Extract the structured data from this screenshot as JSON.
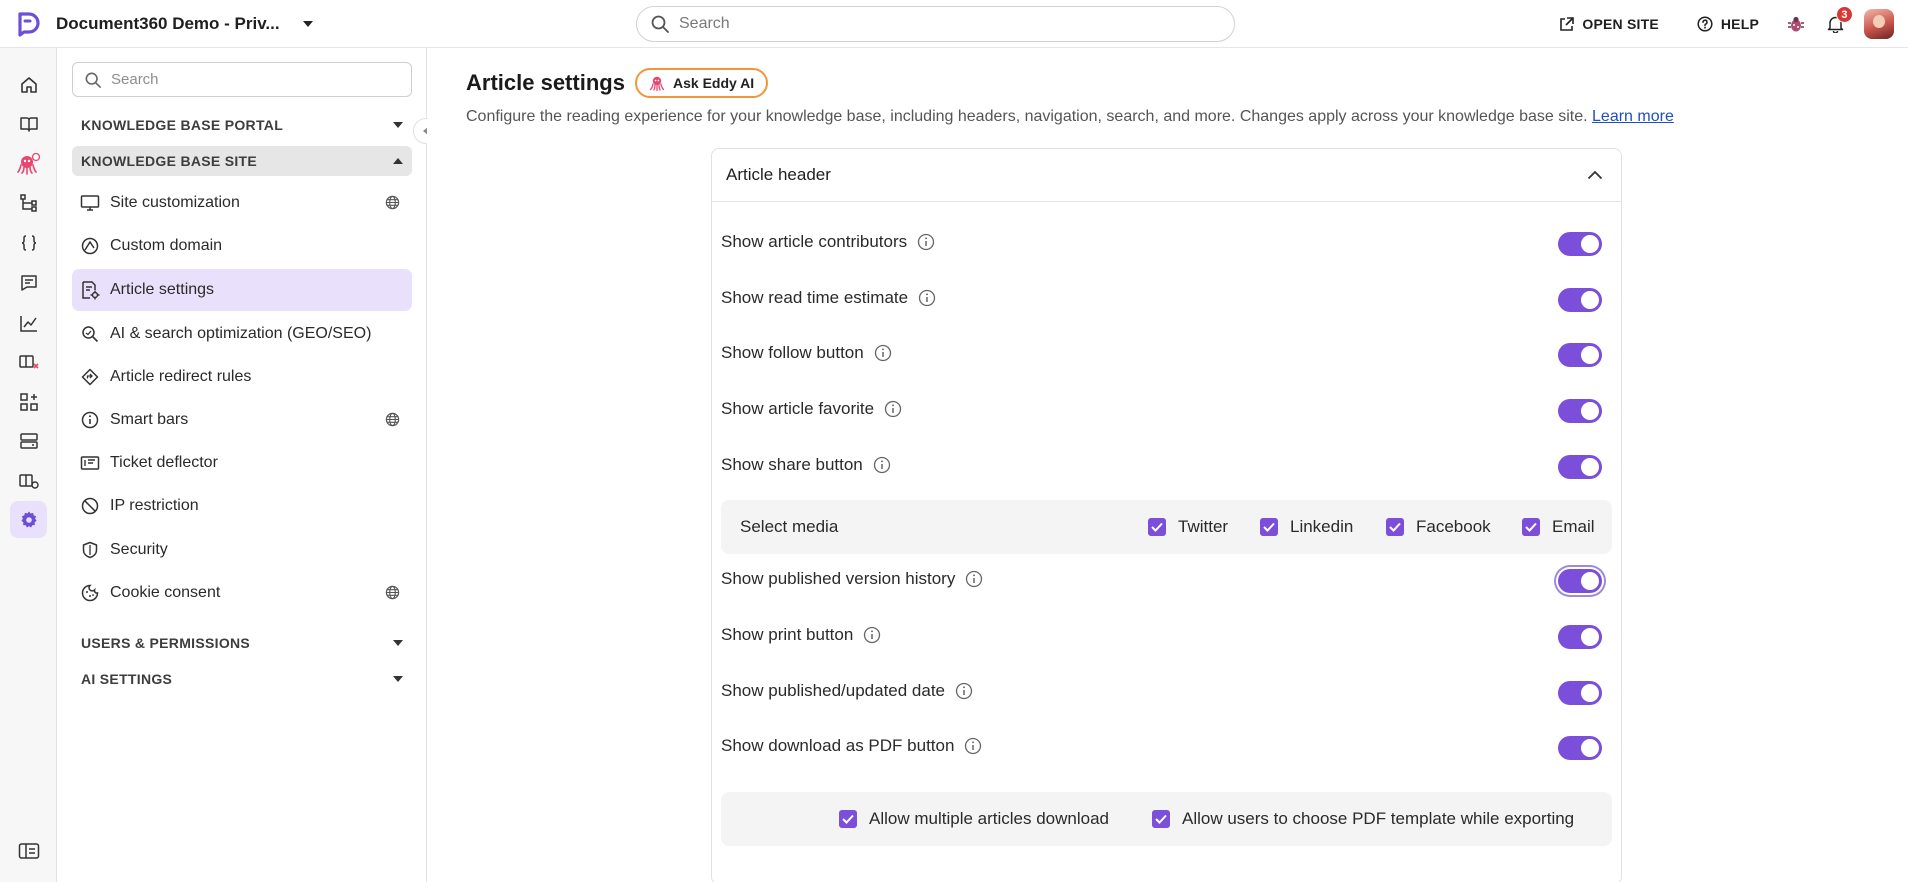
{
  "topbar": {
    "project_name": "Document360 Demo - Priv...",
    "search_placeholder": "Search",
    "open_site": "OPEN SITE",
    "help": "HELP",
    "notifications_count": "3"
  },
  "sidebar": {
    "search_placeholder": "Search",
    "sections": {
      "portal": "KNOWLEDGE BASE PORTAL",
      "site": "KNOWLEDGE BASE SITE",
      "users": "USERS & PERMISSIONS",
      "ai": "AI SETTINGS"
    },
    "items": [
      {
        "label": "Site customization",
        "icon": "monitor-icon",
        "globe": true
      },
      {
        "label": "Custom domain",
        "icon": "domain-icon",
        "globe": false
      },
      {
        "label": "Article settings",
        "icon": "article-settings-icon",
        "globe": false,
        "active": true
      },
      {
        "label": "AI & search optimization (GEO/SEO)",
        "icon": "search-optimization-icon",
        "globe": false
      },
      {
        "label": "Article redirect rules",
        "icon": "redirect-icon",
        "globe": false
      },
      {
        "label": "Smart bars",
        "icon": "info-icon",
        "globe": true
      },
      {
        "label": "Ticket deflector",
        "icon": "ticket-icon",
        "globe": false
      },
      {
        "label": "IP restriction",
        "icon": "block-icon",
        "globe": false
      },
      {
        "label": "Security",
        "icon": "shield-icon",
        "globe": false
      },
      {
        "label": "Cookie consent",
        "icon": "cookie-icon",
        "globe": true
      }
    ]
  },
  "main": {
    "title": "Article settings",
    "ask_eddy": "Ask Eddy AI",
    "description": "Configure the reading experience for your knowledge base, including headers, navigation, search, and more. Changes apply across your knowledge base site.",
    "learn_more": "Learn more",
    "panel_title": "Article header",
    "rows": [
      {
        "label": "Show article contributors",
        "on": true
      },
      {
        "label": "Show read time estimate",
        "on": true
      },
      {
        "label": "Show follow button",
        "on": true
      },
      {
        "label": "Show article favorite",
        "on": true
      },
      {
        "label": "Show share button",
        "on": true
      },
      {
        "label": "Show published version history",
        "on": true
      },
      {
        "label": "Show print button",
        "on": true
      },
      {
        "label": "Show published/updated date",
        "on": true
      },
      {
        "label": "Show download as PDF button",
        "on": true
      }
    ],
    "media": {
      "label": "Select media",
      "options": [
        "Twitter",
        "Linkedin",
        "Facebook",
        "Email"
      ]
    },
    "pdf_options": [
      "Allow multiple articles download",
      "Allow users to choose PDF template while exporting"
    ]
  },
  "colors": {
    "accent": "#7b4fd9",
    "active_bg": "#e9e1fb",
    "eddy_border": "#f4943b",
    "badge": "#d93636",
    "logo": "#6c4fd6"
  }
}
